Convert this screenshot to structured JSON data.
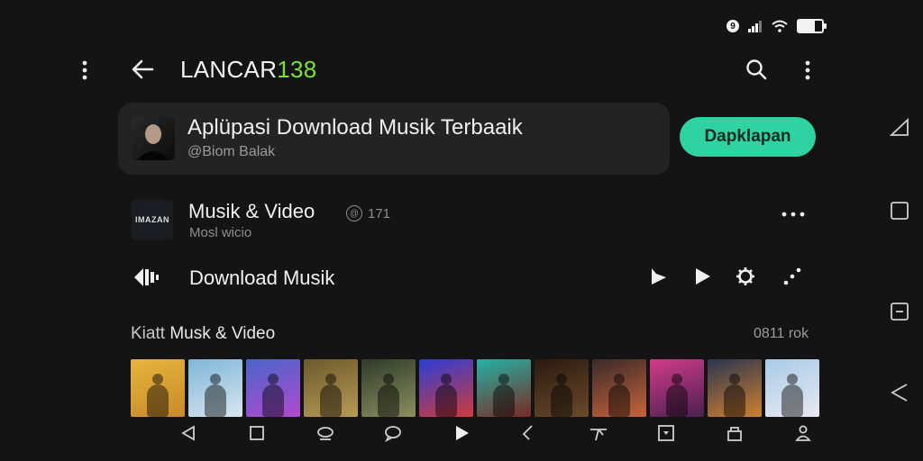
{
  "status": {
    "notification_badge": "9"
  },
  "app_bar": {
    "brand_main": "LANCAR",
    "brand_accent": "138",
    "accent_color": "#7ee03f"
  },
  "featured": {
    "title": "Aplüpasi Download Musik Terbaaik",
    "subtitle": "@Biom Balak",
    "cta_label": "Dapklapan",
    "cta_color": "#2fd3a2"
  },
  "item_video": {
    "thumb_text": "IMAZAN",
    "title": "Musik & Video",
    "subtitle": "Mosl wicio",
    "count": "171",
    "count_icon": "@"
  },
  "item_download": {
    "title": "Download Musik"
  },
  "section": {
    "title_prefix": "Kiatt",
    "title": "Musk & Video",
    "right_text": "0811 rok"
  },
  "thumbnails": [
    {
      "name": "thumb-1",
      "colors": [
        "#e6b53c",
        "#c98a2a"
      ]
    },
    {
      "name": "thumb-2",
      "colors": [
        "#7fb6d9",
        "#d8e6ee"
      ]
    },
    {
      "name": "thumb-3",
      "colors": [
        "#4a66c9",
        "#b04ad0"
      ]
    },
    {
      "name": "thumb-4",
      "colors": [
        "#6b5a2c",
        "#b99a55"
      ]
    },
    {
      "name": "thumb-5",
      "colors": [
        "#2f3b2a",
        "#8a8f5e"
      ]
    },
    {
      "name": "thumb-6",
      "colors": [
        "#2b3fd6",
        "#d03a3a"
      ]
    },
    {
      "name": "thumb-7",
      "colors": [
        "#23b3a8",
        "#7a2a22"
      ]
    },
    {
      "name": "thumb-8",
      "colors": [
        "#2a1a10",
        "#6a4a2a"
      ]
    },
    {
      "name": "thumb-9",
      "colors": [
        "#3a2a2a",
        "#c7643b"
      ]
    },
    {
      "name": "thumb-10",
      "colors": [
        "#d23c8a",
        "#4a2050"
      ]
    },
    {
      "name": "thumb-11",
      "colors": [
        "#2a3550",
        "#d08030"
      ]
    },
    {
      "name": "thumb-12",
      "colors": [
        "#a8cce8",
        "#e8e8f0"
      ]
    }
  ]
}
